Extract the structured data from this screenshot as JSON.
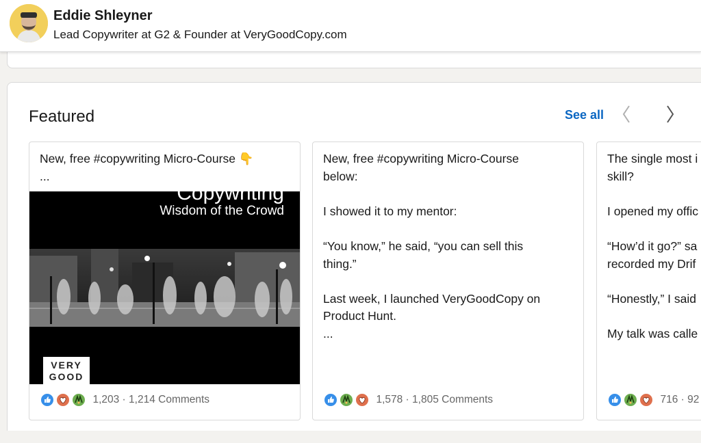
{
  "profile": {
    "name": "Eddie Shleyner",
    "headline": "Lead Copywriter at G2 & Founder at VeryGoodCopy.com",
    "avatar_icon": "avatar-photo"
  },
  "featured": {
    "title": "Featured",
    "see_all": "See all",
    "prev_icon": "chevron-left-icon",
    "next_icon": "chevron-right-icon",
    "cards": [
      {
        "lines": [
          "New, free #copywriting Micro-Course 👇",
          "..."
        ],
        "image": {
          "title": "Copywriting",
          "subtitle": "Wisdom of the Crowd",
          "logo_line1": "VERY",
          "logo_line2": "GOOD"
        },
        "reactions": [
          "like-icon",
          "love-icon",
          "celebrate-icon"
        ],
        "likes": "1,203",
        "comments": "1,214 Comments"
      },
      {
        "lines": [
          "New, free #copywriting Micro-Course",
          "below:",
          "",
          "I showed it to my mentor:",
          "",
          "“You know,” he said, “you can sell this",
          "thing.”",
          "",
          "Last week, I launched VeryGoodCopy on",
          "Product Hunt.",
          "..."
        ],
        "reactions": [
          "like-icon",
          "celebrate-icon",
          "love-icon"
        ],
        "likes": "1,578",
        "comments": "1,805 Comments"
      },
      {
        "lines": [
          "The single most i",
          "skill?",
          "",
          "I opened my offic",
          "",
          "“How’d it go?” sa",
          "recorded my Drif",
          "",
          "“Honestly,” I said",
          "",
          "My talk was calle"
        ],
        "reactions": [
          "like-icon",
          "celebrate-icon",
          "love-icon"
        ],
        "likes": "716",
        "comments": "92"
      }
    ]
  },
  "colors": {
    "link_blue": "#0a66c2",
    "avatar_bg": "#f2cf5b",
    "like_blue": "#378fe9",
    "love_red": "#df704d",
    "celebrate_green": "#44712e"
  }
}
